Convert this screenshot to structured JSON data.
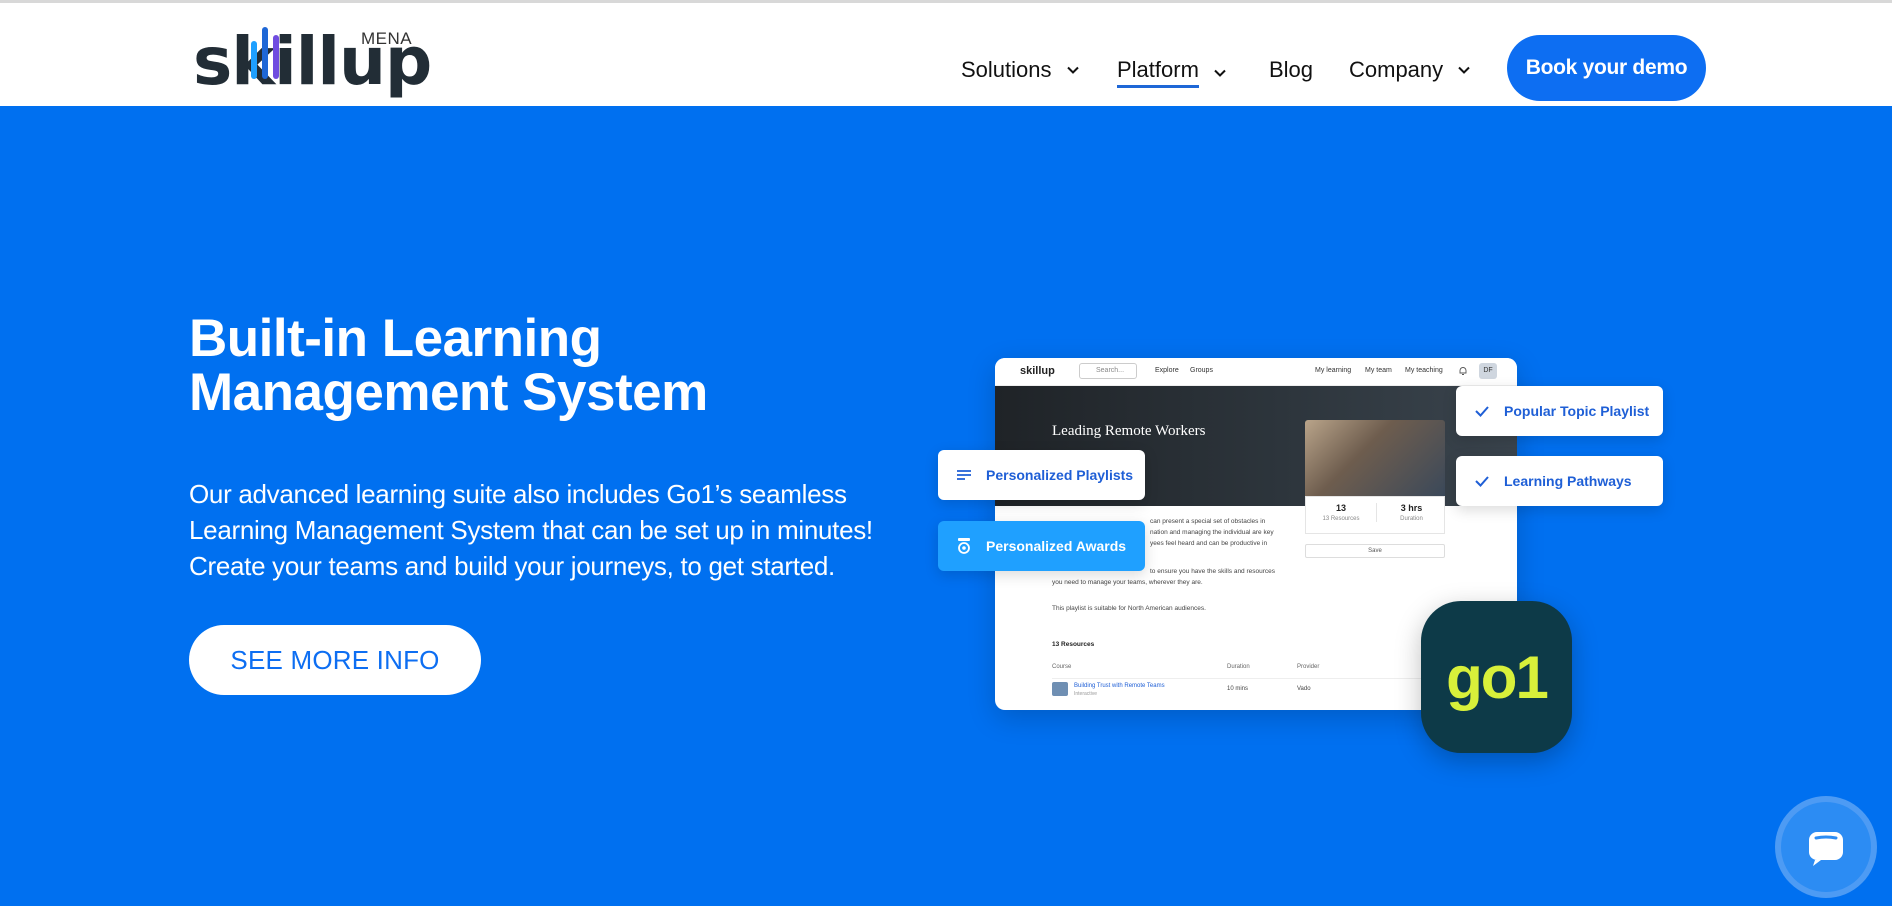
{
  "header": {
    "logo_text": "skillup",
    "logo_suffix": "MENA",
    "nav": [
      {
        "label": "Solutions",
        "dropdown": true
      },
      {
        "label": "Platform",
        "dropdown": true,
        "active": true
      },
      {
        "label": "Blog",
        "dropdown": false
      },
      {
        "label": "Company",
        "dropdown": true
      }
    ],
    "cta_label": "Book your demo"
  },
  "hero": {
    "title": "Built-in Learning Management System",
    "description": "Our advanced learning suite also includes Go1’s seamless Learning Management System that can be set up in minutes! Create your teams and build your journeys, to get started.",
    "button_label": "SEE MORE INFO"
  },
  "mockup": {
    "logo": "skillup",
    "search_placeholder": "Search...",
    "links": [
      "Explore",
      "Groups"
    ],
    "right_links": [
      "My learning",
      "My team",
      "My teaching"
    ],
    "avatar_initials": "DF",
    "banner_title": "Leading Remote Workers",
    "stats": [
      {
        "value": "13",
        "label": "13 Resources"
      },
      {
        "value": "3 hrs",
        "label": "Duration"
      }
    ],
    "save_label": "Save",
    "desc_lines": [
      "can present a special set of obstacles in",
      "nation and managing the individual are key",
      "yees feel heard and can be productive in"
    ],
    "desc_para2": [
      "to ensure you have the skills and resources",
      "you need to manage your teams, wherever they are."
    ],
    "suitable_text": "This playlist is suitable for North American audiences.",
    "resources_heading": "13 Resources",
    "table_headers": [
      "Course",
      "Duration",
      "Provider"
    ],
    "table_row": {
      "course": "Building Trust with Remote Teams",
      "sub": "Interactive",
      "duration": "10 mins",
      "provider": "Vado"
    }
  },
  "tags": {
    "playlists": "Personalized Playlists",
    "awards": "Personalized Awards",
    "popular": "Popular Topic Playlist",
    "pathways": "Learning Pathways"
  },
  "go1_label": "go1",
  "colors": {
    "brand_blue": "#0070f0",
    "button_blue": "#0d6ef2",
    "go1_bg": "#0d3a48",
    "go1_text": "#d8f03a"
  }
}
